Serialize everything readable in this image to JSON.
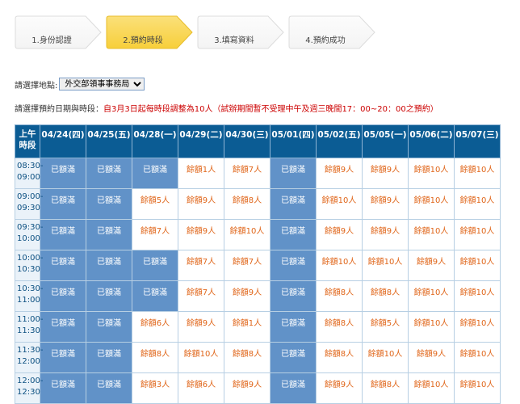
{
  "steps": [
    {
      "label": "1.身份認證",
      "active": false
    },
    {
      "label": "2.預約時段",
      "active": true
    },
    {
      "label": "3.填寫資料",
      "active": false
    },
    {
      "label": "4.預約成功",
      "active": false
    }
  ],
  "location": {
    "label": "請選擇地點:",
    "selected": "外交部領事事務局"
  },
  "note": {
    "label": "請選擇預約日期與時段：",
    "message": "自3月3日起每時段調整為10人（試辦期間暫不受理中午及週三晚間17：00~20：00之預約）"
  },
  "table": {
    "corner": [
      "上午",
      "時段"
    ],
    "dates": [
      "04/24(四)",
      "04/25(五)",
      "04/28(一)",
      "04/29(二)",
      "04/30(三)",
      "05/01(四)",
      "05/02(五)",
      "05/05(一)",
      "05/06(二)",
      "05/07(三)"
    ],
    "full_label": "已額滿",
    "rows": [
      {
        "time": [
          "08:30-",
          "09:00"
        ],
        "cells": [
          "已額滿",
          "已額滿",
          "已額滿",
          "餘額1人",
          "餘額7人",
          "已額滿",
          "餘額9人",
          "餘額9人",
          "餘額10人",
          "餘額10人"
        ]
      },
      {
        "time": [
          "09:00-",
          "09:30"
        ],
        "cells": [
          "已額滿",
          "已額滿",
          "餘額5人",
          "餘額9人",
          "餘額8人",
          "已額滿",
          "餘額10人",
          "餘額9人",
          "餘額10人",
          "餘額10人"
        ]
      },
      {
        "time": [
          "09:30-",
          "10:00"
        ],
        "cells": [
          "已額滿",
          "已額滿",
          "餘額7人",
          "餘額9人",
          "餘額10人",
          "已額滿",
          "餘額9人",
          "餘額9人",
          "餘額10人",
          "餘額10人"
        ]
      },
      {
        "time": [
          "10:00-",
          "10:30"
        ],
        "cells": [
          "已額滿",
          "已額滿",
          "已額滿",
          "餘額7人",
          "餘額7人",
          "已額滿",
          "餘額10人",
          "餘額10人",
          "餘額9人",
          "餘額10人"
        ]
      },
      {
        "time": [
          "10:30-",
          "11:00"
        ],
        "cells": [
          "已額滿",
          "已額滿",
          "已額滿",
          "餘額7人",
          "餘額9人",
          "已額滿",
          "餘額8人",
          "餘額8人",
          "餘額10人",
          "餘額10人"
        ]
      },
      {
        "time": [
          "11:00-",
          "11:30"
        ],
        "cells": [
          "已額滿",
          "已額滿",
          "餘額6人",
          "餘額9人",
          "餘額1人",
          "已額滿",
          "餘額8人",
          "餘額5人",
          "餘額10人",
          "餘額10人"
        ]
      },
      {
        "time": [
          "11:30-",
          "12:00"
        ],
        "cells": [
          "已額滿",
          "已額滿",
          "餘額8人",
          "餘額10人",
          "餘額8人",
          "已額滿",
          "餘額8人",
          "餘額10人",
          "餘額9人",
          "餘額10人"
        ]
      },
      {
        "time": [
          "12:00-",
          "12:30"
        ],
        "cells": [
          "已額滿",
          "已額滿",
          "餘額3人",
          "餘額6人",
          "餘額9人",
          "已額滿",
          "餘額9人",
          "餘額8人",
          "餘額10人",
          "餘額10人"
        ]
      }
    ]
  }
}
